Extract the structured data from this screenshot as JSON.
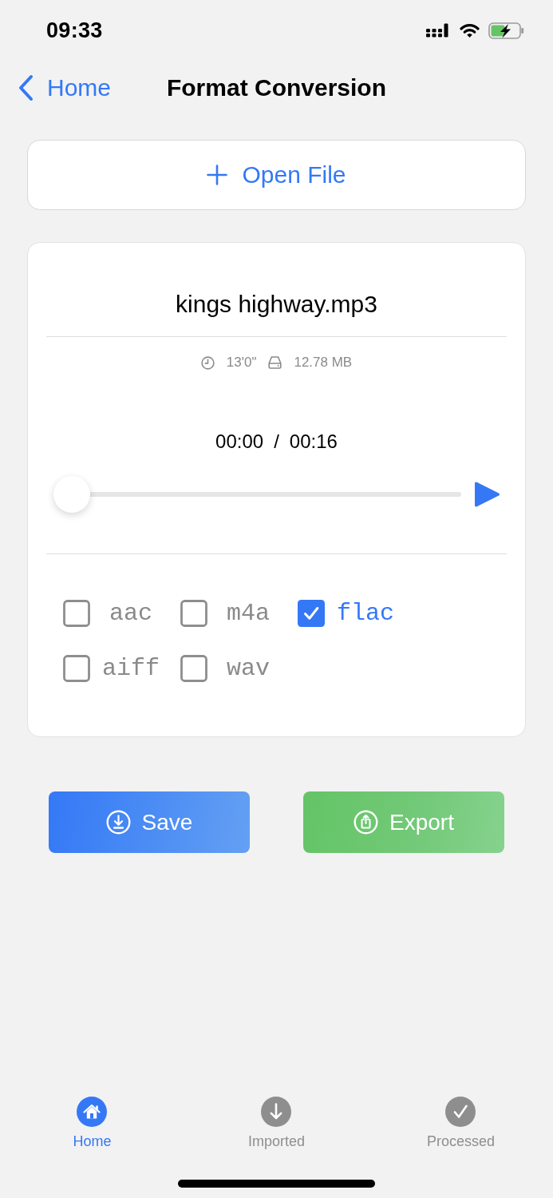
{
  "status_bar": {
    "time": "09:33"
  },
  "nav_bar": {
    "back_label": "Home",
    "title": "Format Conversion"
  },
  "open_file_button": {
    "label": "Open File"
  },
  "file_card": {
    "file_name": "kings highway.mp3",
    "duration": "13'0\"",
    "file_size": "12.78 MB",
    "elapsed": "00:00",
    "separator": "/",
    "total": "00:16",
    "playback": {
      "level": 0
    },
    "formats": [
      {
        "label": "aac",
        "checked": false
      },
      {
        "label": "m4a",
        "checked": false
      },
      {
        "label": "flac",
        "checked": true
      },
      {
        "label": "aiff",
        "checked": false
      },
      {
        "label": "wav",
        "checked": false
      }
    ]
  },
  "actions": [
    {
      "kind": "save",
      "label": "Save"
    },
    {
      "kind": "export",
      "label": "Export"
    }
  ],
  "tab_bar": {
    "tabs": [
      {
        "kind": "home",
        "label": "Home",
        "selected": true
      },
      {
        "kind": "imported",
        "label": "Imported",
        "selected": false
      },
      {
        "kind": "processed",
        "label": "Processed",
        "selected": false
      }
    ]
  }
}
